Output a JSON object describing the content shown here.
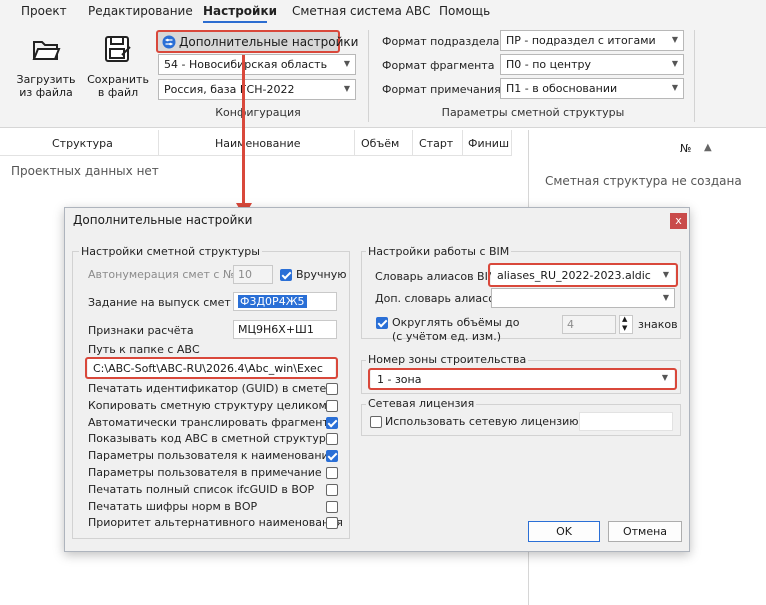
{
  "menu": {
    "items": [
      "Проект",
      "Редактирование",
      "Настройки",
      "Сметная система АВС",
      "Помощь"
    ],
    "active_index": 2
  },
  "ribbon": {
    "load_label": "Загрузить из файла",
    "save_label": "Сохранить в файл",
    "extra_settings_label": "Дополнительные настройки",
    "region_value": "54 - Новосибирская область",
    "base_value": "Россия, база ГСН-2022",
    "config_group_label": "Конфигурация",
    "subsection_label": "Формат подраздела",
    "subsection_value": "ПР - подраздел с итогами",
    "fragment_label": "Формат фрагмента",
    "fragment_value": "П0 - по центру",
    "note_label": "Формат примечания",
    "note_value": "П1 - в обосновании",
    "params_group_label": "Параметры сметной структуры"
  },
  "grid": {
    "columns": [
      "Структура",
      "Наименование",
      "Объём",
      "Старт",
      "Финиш"
    ],
    "empty_text": "Проектных данных нет"
  },
  "right_panel": {
    "col_no": "№",
    "empty_text": "Сметная структура не создана"
  },
  "dialog": {
    "title": "Дополнительные настройки",
    "close_label": "x",
    "structure_group": {
      "title": "Настройки сметной структуры",
      "autonum_label": "Автонумерация смет с №",
      "autonum_value": "10",
      "manual_label": "Вручную",
      "release_label": "Задание на выпуск смет",
      "release_value": "Ф3Д0Р4Ж5",
      "calc_label": "Признаки расчёта",
      "calc_value": "МЦ9Н6Х+Ш1",
      "path_label": "Путь к папке с АВС",
      "path_value": "C:\\ABC-Soft\\ABC-RU\\2026.4\\Abc_win\\Exec",
      "options": [
        {
          "label": "Печатать идентификатор (GUID) в смете",
          "checked": false
        },
        {
          "label": "Копировать сметную структуру целиком",
          "checked": false
        },
        {
          "label": "Автоматически транслировать фрагменты",
          "checked": true
        },
        {
          "label": "Показывать код АВС в сметной структуре",
          "checked": false
        },
        {
          "label": "Параметры пользователя к наименованию",
          "checked": true
        },
        {
          "label": "Параметры пользователя в примечание",
          "checked": false
        },
        {
          "label": "Печатать полный список ifcGUID в ВОР",
          "checked": false
        },
        {
          "label": "Печатать шифры норм в ВОР",
          "checked": false
        },
        {
          "label": "Приоритет альтернативного наименования",
          "checked": false
        }
      ]
    },
    "bim_group": {
      "title": "Настройки работы с BIM",
      "alias_label": "Словарь алиасов BIM",
      "alias_value": "aliases_RU_2022-2023.aldic",
      "extra_alias_label": "Доп. словарь алиасов",
      "extra_alias_value": "",
      "round_label_1": "Округлять объёмы до",
      "round_label_2": "(с учётом ед. изм.)",
      "round_value": "4",
      "round_unit": "знаков"
    },
    "zone_group": {
      "title": "Номер зоны строительства",
      "zone_value": "1 - зона"
    },
    "license_group": {
      "title": "Сетевая лицензия",
      "use_label": "Использовать сетевую лицензию",
      "use_value": ""
    },
    "ok_label": "OK",
    "cancel_label": "Отмена"
  },
  "colors": {
    "accent": "#2a6fd6",
    "highlight": "#d9483b"
  }
}
